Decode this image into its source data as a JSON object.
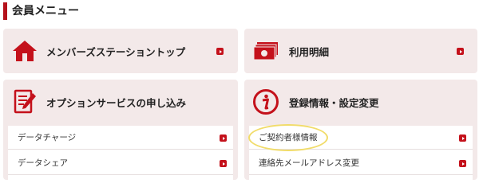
{
  "section": {
    "title": "会員メニュー"
  },
  "cards": {
    "top_left": {
      "label": "メンバーズステーショントップ",
      "icon": "home-icon"
    },
    "top_right": {
      "label": "利用明細",
      "icon": "banknote-icon"
    },
    "bottom_left": {
      "label": "オプションサービスの申し込み",
      "icon": "form-edit-icon",
      "items": [
        {
          "label": "データチャージ"
        },
        {
          "label": "データシェア"
        }
      ]
    },
    "bottom_right": {
      "label": "登録情報・設定変更",
      "icon": "info-icon",
      "items": [
        {
          "label": "ご契約者様情報"
        },
        {
          "label": "連絡先メールアドレス変更"
        }
      ]
    }
  },
  "colors": {
    "accent": "#c4111b",
    "card_bg": "#f3e9e9",
    "highlight": "#f1dc6a"
  }
}
